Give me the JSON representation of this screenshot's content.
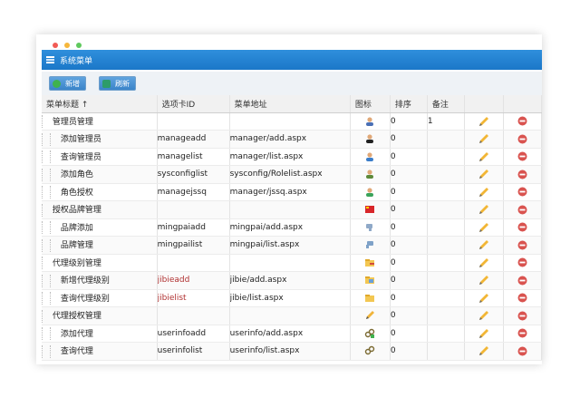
{
  "window": {
    "title": "系统菜单"
  },
  "toolbar": {
    "add_label": "新增",
    "refresh_label": "刷新"
  },
  "columns": [
    "菜单标题",
    "选项卡ID",
    "菜单地址",
    "图标",
    "排序",
    "备注"
  ],
  "colors": {
    "title_bar": "#1b77c8",
    "delete": "#d9534f",
    "edit": "#e0a020"
  },
  "rows": [
    {
      "title": "管理员管理",
      "tab": "",
      "url": "",
      "icon": "user-manager-icon",
      "sort": "0",
      "note": "1",
      "indent": 1
    },
    {
      "title": "添加管理员",
      "tab": "manageadd",
      "url": "manager/add.aspx",
      "icon": "user-black-icon",
      "sort": "0",
      "note": "",
      "indent": 2
    },
    {
      "title": "查询管理员",
      "tab": "managelist",
      "url": "manager/list.aspx",
      "icon": "user-search-icon",
      "sort": "0",
      "note": "",
      "indent": 2
    },
    {
      "title": "添加角色",
      "tab": "sysconfiglist",
      "url": "sysconfig/Rolelist.aspx",
      "icon": "user-add-icon",
      "sort": "0",
      "note": "",
      "indent": 2
    },
    {
      "title": "角色授权",
      "tab": "managejssq",
      "url": "manager/jssq.aspx",
      "icon": "user-go-icon",
      "sort": "0",
      "note": "",
      "indent": 2
    },
    {
      "title": "授权品牌管理",
      "tab": "",
      "url": "",
      "icon": "flag-red-icon",
      "sort": "0",
      "note": "",
      "indent": 1
    },
    {
      "title": "品牌添加",
      "tab": "mingpaiadd",
      "url": "mingpai/add.aspx",
      "icon": "thumb-down-icon",
      "sort": "0",
      "note": "",
      "indent": 2
    },
    {
      "title": "品牌管理",
      "tab": "mingpailist",
      "url": "mingpai/list.aspx",
      "icon": "thumb-icon",
      "sort": "0",
      "note": "",
      "indent": 2
    },
    {
      "title": "代理级别管理",
      "tab": "",
      "url": "",
      "icon": "folder-edit-icon",
      "sort": "0",
      "note": "",
      "indent": 1
    },
    {
      "title": "新增代理级别",
      "tab": "jibieadd",
      "url": "jibie/add.aspx",
      "icon": "folder-image-icon",
      "sort": "0",
      "note": "",
      "indent": 2
    },
    {
      "title": "查询代理级别",
      "tab": "jibielist",
      "url": "jibie/list.aspx",
      "icon": "folder-open-icon",
      "sort": "0",
      "note": "",
      "indent": 2
    },
    {
      "title": "代理授权管理",
      "tab": "",
      "url": "",
      "icon": "pencil-icon",
      "sort": "0",
      "note": "",
      "indent": 1
    },
    {
      "title": "添加代理",
      "tab": "userinfoadd",
      "url": "userinfo/add.aspx",
      "icon": "link-add-icon",
      "sort": "0",
      "note": "",
      "indent": 2
    },
    {
      "title": "查询代理",
      "tab": "userinfolist",
      "url": "userinfo/list.aspx",
      "icon": "link-icon",
      "sort": "0",
      "note": "",
      "indent": 2
    }
  ]
}
